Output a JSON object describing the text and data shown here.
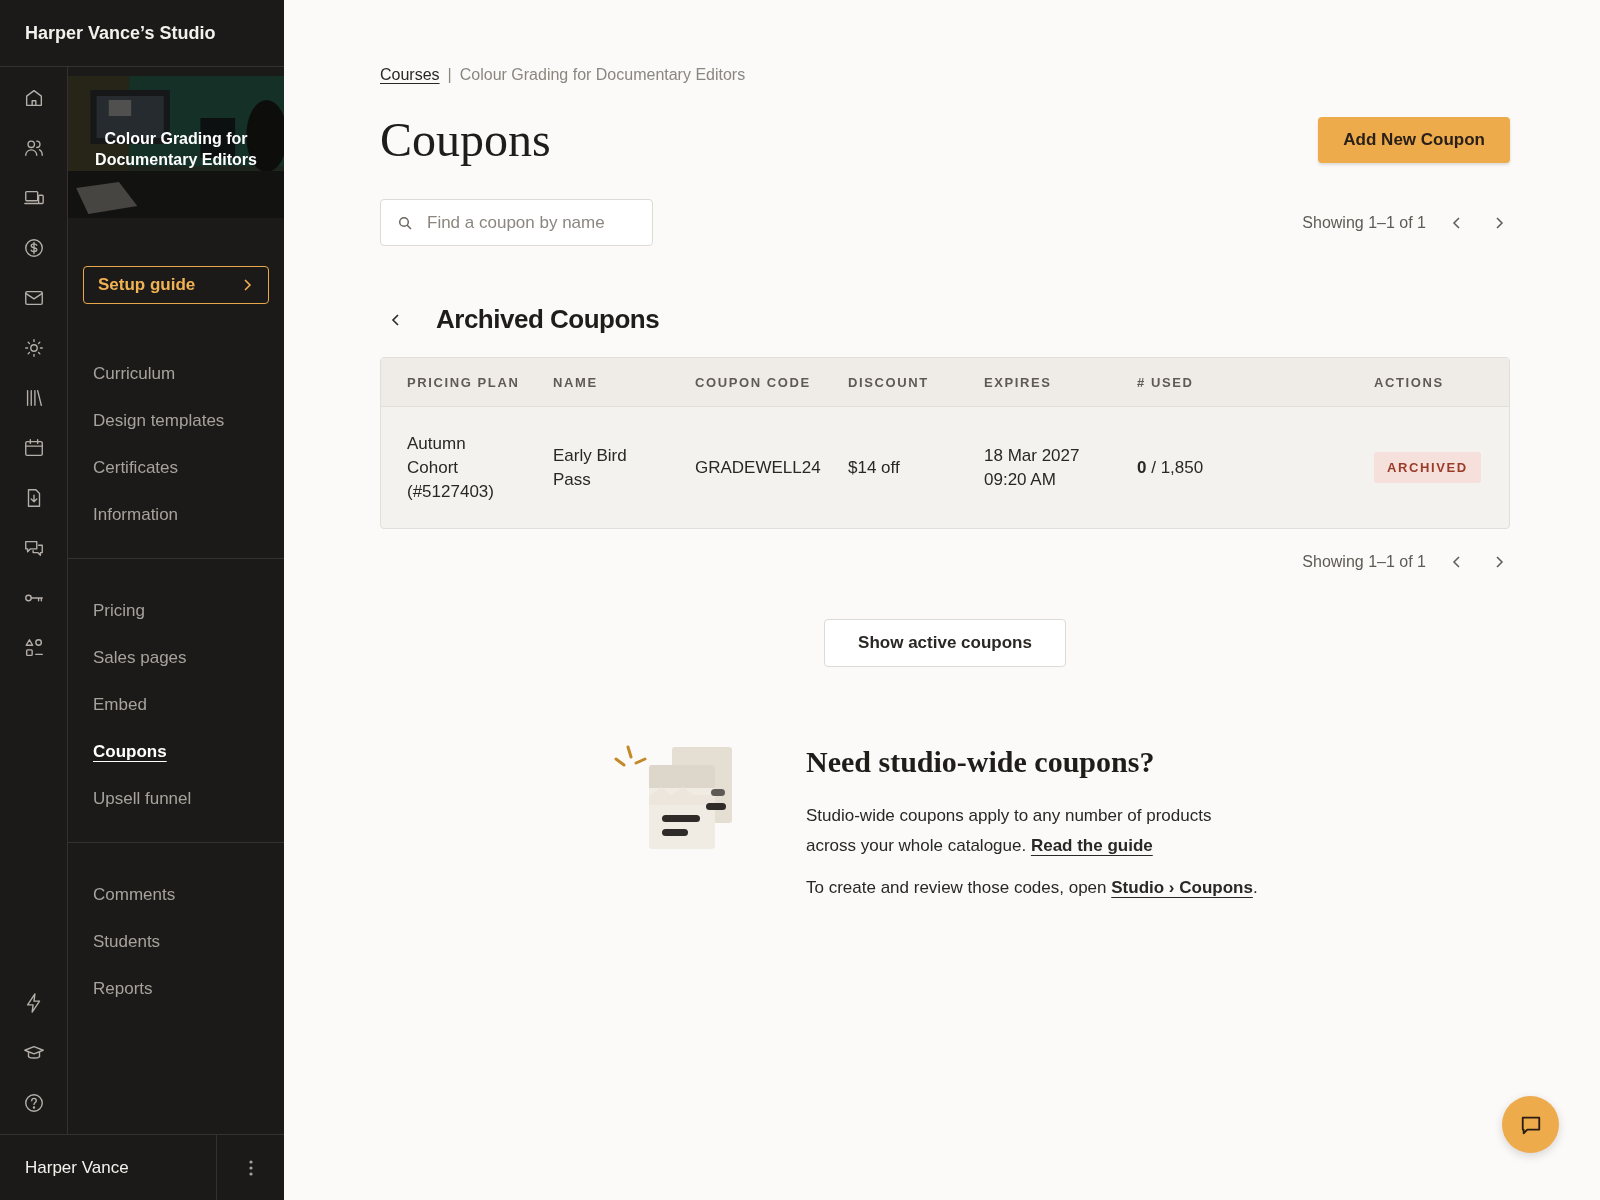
{
  "studio": {
    "title": "Harper Vance’s Studio"
  },
  "course": {
    "title": "Colour Grading for Documentary Editors"
  },
  "setup_guide": {
    "label": "Setup guide"
  },
  "nav_groups": [
    [
      {
        "label": "Curriculum",
        "selected": false
      },
      {
        "label": "Design templates",
        "selected": false
      },
      {
        "label": "Certificates",
        "selected": false
      },
      {
        "label": "Information",
        "selected": false
      }
    ],
    [
      {
        "label": "Pricing",
        "selected": false
      },
      {
        "label": "Sales pages",
        "selected": false
      },
      {
        "label": "Embed",
        "selected": false
      },
      {
        "label": "Coupons",
        "selected": true
      },
      {
        "label": "Upsell funnel",
        "selected": false
      }
    ],
    [
      {
        "label": "Comments",
        "selected": false
      },
      {
        "label": "Students",
        "selected": false
      },
      {
        "label": "Reports",
        "selected": false
      }
    ]
  ],
  "user": {
    "name": "Harper Vance"
  },
  "breadcrumb": {
    "link": "Courses",
    "separator": "|",
    "current": "Colour Grading for Documentary Editors"
  },
  "page_title": "Coupons",
  "add_button": "Add New Coupon",
  "search": {
    "placeholder": "Find a coupon by name"
  },
  "pagination_top": "Showing 1–1 of 1",
  "section_title": "Archived Coupons",
  "table": {
    "columns": [
      "PRICING PLAN",
      "NAME",
      "COUPON CODE",
      "DISCOUNT",
      "EXPIRES",
      "# USED",
      "ACTIONS"
    ],
    "rows": [
      {
        "pricing_plan": "Autumn Cohort (#5127403)",
        "name": "Early Bird Pass",
        "code": "GRADEWELL24",
        "discount": "$14 off",
        "expires": [
          "18 Mar 2027",
          "09:20 AM"
        ],
        "used": "**0** / 1,850",
        "status": "ARCHIVED"
      }
    ]
  },
  "pagination_bottom": "Showing 1–1 of 1",
  "toggle_button": "Show active coupons",
  "promo": {
    "title": "Need studio-wide coupons?",
    "paragraphs": [
      {
        "text": "Studio-wide coupons apply to any number of products across your whole catalogue. ",
        "link": "Read the guide"
      },
      {
        "text": "To create and review those codes, open ",
        "link": "Studio › Coupons",
        "after": "."
      }
    ]
  }
}
